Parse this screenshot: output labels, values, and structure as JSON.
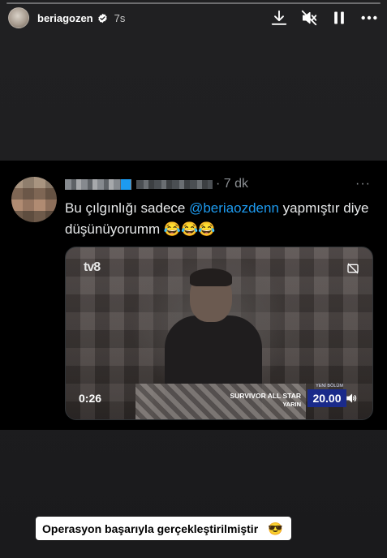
{
  "story": {
    "progress": 0.0,
    "username": "beriagozen",
    "time_ago": "7s"
  },
  "icons": {
    "download": "download-icon",
    "mute": "speaker-muted-icon",
    "pause": "pause-icon",
    "more": "more-horizontal-icon",
    "verified": "verified-badge-icon"
  },
  "tweet": {
    "time": "· 7 dk",
    "more_glyph": "···",
    "text_before": "Bu çılgınlığı sadece ",
    "mention": "@beriaozdenn",
    "text_after": " yapmıştır diye düşünüyorumm 😂😂😂"
  },
  "video": {
    "channel_logo": "tv8",
    "duration": "0:26",
    "promo_title": "SURVIVOR ALL STAR",
    "promo_day": "YARIN",
    "promo_label": "YENİ BÖLÜM",
    "promo_time": "20.00"
  },
  "caption": {
    "text": "Operasyon başarıyla gerçekleştirilmiştir",
    "emoji": "😎"
  },
  "colors": {
    "mention": "#1d9bf0",
    "verified": "#ffffff",
    "promo_bg": "#1a2a8a"
  }
}
